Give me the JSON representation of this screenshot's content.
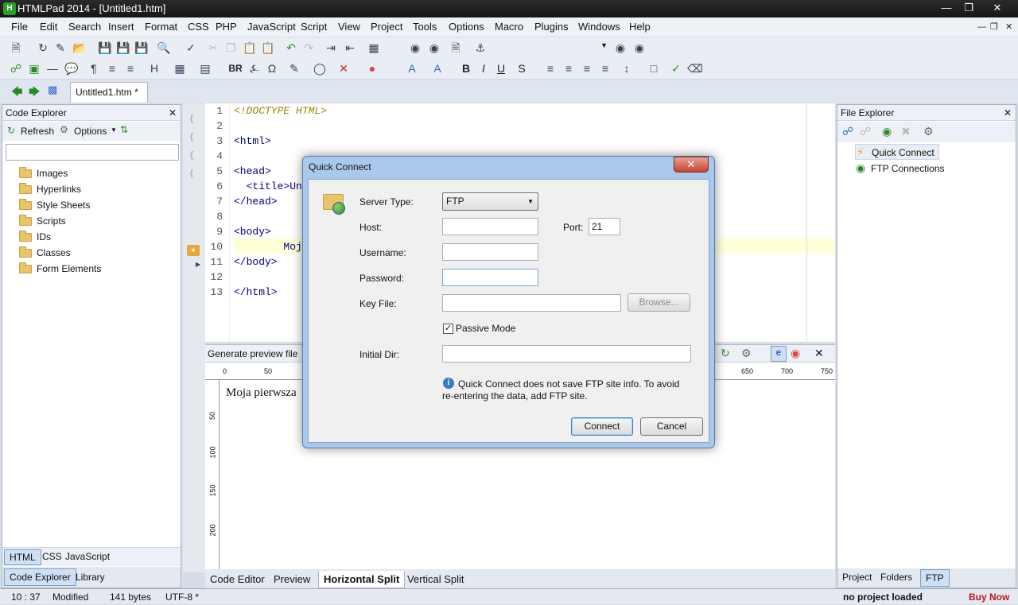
{
  "app": {
    "title": "HTMLPad 2014 - [Untitled1.htm]"
  },
  "menu": [
    "File",
    "Edit",
    "Search",
    "Insert",
    "Format",
    "CSS",
    "PHP",
    "JavaScript",
    "Script",
    "View",
    "Project",
    "Tools",
    "Options",
    "Macro",
    "Plugins",
    "Windows",
    "Help"
  ],
  "toolbar": {
    "br_label": "BR"
  },
  "doc_tab": {
    "label": "Untitled1.htm *"
  },
  "code_explorer": {
    "title": "Code Explorer",
    "refresh_label": "Refresh",
    "options_label": "Options",
    "items": [
      "Images",
      "Hyperlinks",
      "Style Sheets",
      "Scripts",
      "IDs",
      "Classes",
      "Form Elements"
    ],
    "lang_tabs": [
      "HTML",
      "CSS",
      "JavaScript"
    ],
    "bottom_tabs": [
      "Code Explorer",
      "Library"
    ]
  },
  "editor": {
    "lines": [
      {
        "n": "1",
        "code": "<!DOCTYPE HTML>"
      },
      {
        "n": "2",
        "code": ""
      },
      {
        "n": "3",
        "code": "<html>"
      },
      {
        "n": "4",
        "code": ""
      },
      {
        "n": "5",
        "code": "<head>"
      },
      {
        "n": "6",
        "code": "  <title>Un"
      },
      {
        "n": "7",
        "code": "</head>"
      },
      {
        "n": "8",
        "code": ""
      },
      {
        "n": "9",
        "code": "<body>"
      },
      {
        "n": "10",
        "code": "        Moj"
      },
      {
        "n": "11",
        "code": "</body>"
      },
      {
        "n": "12",
        "code": ""
      },
      {
        "n": "13",
        "code": "</html>"
      }
    ]
  },
  "preview": {
    "toolbar_label": "Generate preview file",
    "text": "Moja pierwsza",
    "ruler_top": [
      "0",
      "50",
      "650",
      "700",
      "750"
    ],
    "ruler_left": [
      "50",
      "100",
      "150",
      "200"
    ]
  },
  "view_tabs": [
    "Code Editor",
    "Preview",
    "Horizontal Split",
    "Vertical Split"
  ],
  "file_explorer": {
    "title": "File Explorer",
    "items": [
      "Quick Connect",
      "FTP Connections"
    ],
    "bottom_tabs": [
      "Project",
      "Folders",
      "FTP"
    ]
  },
  "status": {
    "position": "10 : 37",
    "state": "Modified",
    "size": "141 bytes",
    "encoding": "UTF-8 *",
    "project": "no project loaded",
    "buy": "Buy Now"
  },
  "dialog": {
    "title": "Quick Connect",
    "server_type_label": "Server Type:",
    "server_type_value": "FTP",
    "host_label": "Host:",
    "host_value": "",
    "port_label": "Port:",
    "port_value": "21",
    "username_label": "Username:",
    "username_value": "",
    "password_label": "Password:",
    "password_value": "",
    "keyfile_label": "Key File:",
    "keyfile_value": "",
    "browse_label": "Browse...",
    "passive_label": "Passive Mode",
    "passive_checked": true,
    "initial_dir_label": "Initial Dir:",
    "initial_dir_value": "",
    "info_line1": "Quick Connect does not save FTP site info. To avoid",
    "info_line2": "re-entering the data, add FTP site.",
    "connect_label": "Connect",
    "cancel_label": "Cancel"
  }
}
